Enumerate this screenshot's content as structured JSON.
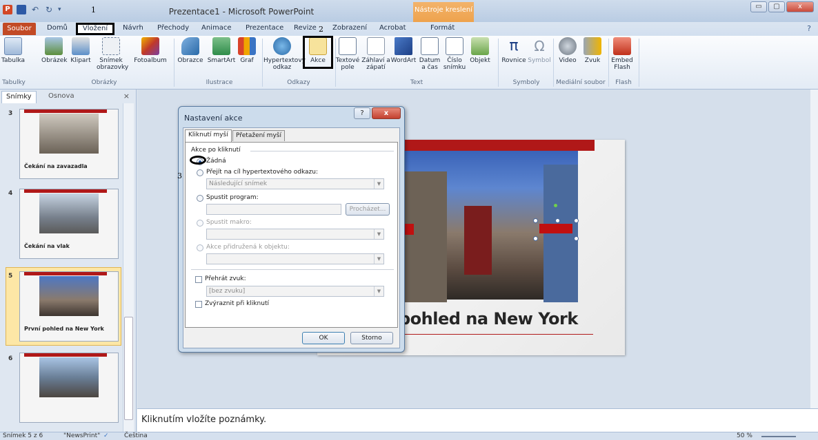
{
  "window": {
    "title": "Prezentace1 - Microsoft PowerPoint",
    "context_tab_group": "Nástroje kreslení",
    "qat_annotation": "1",
    "help_glyph": "?",
    "minimize": "▭",
    "maximize": "▢",
    "close": "x"
  },
  "tabs": {
    "file": "Soubor",
    "home": "Domů",
    "insert": "Vložení",
    "design": "Návrh",
    "transitions": "Přechody",
    "animations": "Animace",
    "slideshow": "Prezentace",
    "review": "Revize",
    "view": "Zobrazení",
    "acrobat": "Acrobat",
    "format": "Formát",
    "annotation_2": "2"
  },
  "ribbon": {
    "table": "Tabulka",
    "picture": "Obrázek",
    "clipart": "Klipart",
    "screenshot": "Snímek obrazovky",
    "photoalbum": "Fotoalbum",
    "shapes": "Obrazce",
    "smartart": "SmartArt",
    "chart": "Graf",
    "hyperlink": "Hypertextový odkaz",
    "action": "Akce",
    "textbox": "Textové pole",
    "header_footer": "Záhlaví a zápatí",
    "wordart": "WordArt",
    "datetime": "Datum a čas",
    "slidenumber": "Číslo snímku",
    "object": "Objekt",
    "equation": "Rovnice",
    "symbol": "Symbol",
    "video": "Video",
    "audio": "Zvuk",
    "embed_flash": "Embed Flash",
    "groups": {
      "tables": "Tabulky",
      "images": "Obrázky",
      "illustrations": "Ilustrace",
      "links": "Odkazy",
      "text": "Text",
      "symbols": "Symboly",
      "media": "Mediální soubor",
      "flash": "Flash"
    }
  },
  "panel": {
    "tab_slides": "Snímky",
    "tab_outline": "Osnova",
    "close": "×",
    "slides": [
      {
        "num": "3",
        "caption": "Čekání na zavazadla"
      },
      {
        "num": "4",
        "caption": "Čekání na vlak"
      },
      {
        "num": "5",
        "caption": "První pohled na New York"
      },
      {
        "num": "6",
        "caption": ""
      }
    ]
  },
  "slide": {
    "title": "pohled na New York"
  },
  "notes": {
    "placeholder": "Kliknutím vložíte poznámky."
  },
  "status": {
    "slide_of": "Snímek 5 z 6",
    "theme": "\"NewsPrint\"",
    "language": "Čeština",
    "zoom": "50 %"
  },
  "dialog": {
    "title": "Nastavení akce",
    "tab_click": "Kliknutí myší",
    "tab_hover": "Přetažení myší",
    "section": "Akce po kliknutí",
    "none": "Žádná",
    "hyperlink": "Přejít na cíl hypertextového odkazu:",
    "hyperlink_value": "Následující snímek",
    "run_program": "Spustit program:",
    "browse": "Procházet...",
    "run_macro": "Spustit makro:",
    "object_action": "Akce přidružená k objektu:",
    "play_sound": "Přehrát zvuk:",
    "sound_value": "[bez zvuku]",
    "highlight": "Zvýraznit při kliknutí",
    "ok": "OK",
    "cancel": "Storno",
    "annotation_3": "3"
  }
}
